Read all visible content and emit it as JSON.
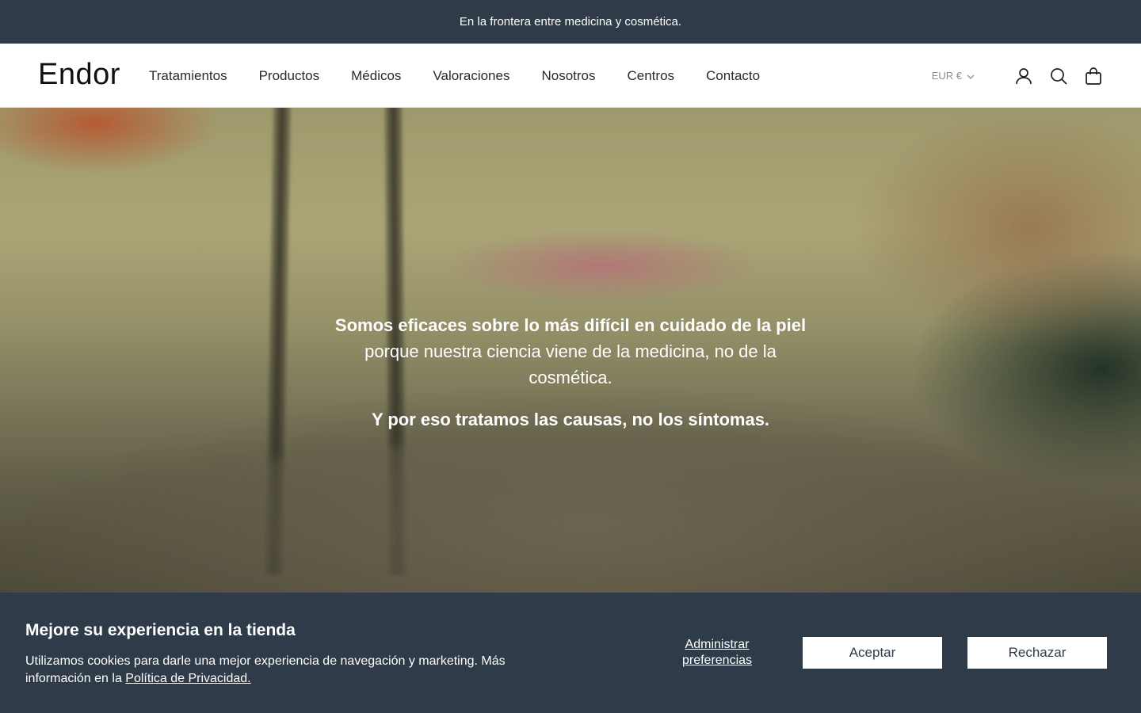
{
  "announcement": {
    "text": "En la frontera entre medicina y cosmética."
  },
  "header": {
    "logo": "Endor",
    "nav": [
      "Tratamientos",
      "Productos",
      "Médicos",
      "Valoraciones",
      "Nosotros",
      "Centros",
      "Contacto"
    ],
    "currency": "EUR €",
    "icons": [
      "account-icon",
      "search-icon",
      "cart-icon"
    ]
  },
  "hero": {
    "lead": "Somos eficaces sobre lo más difícil en cuidado de la piel",
    "body": "porque nuestra ciencia viene de la medicina, no de la cosmética.",
    "emphasis": "Y por eso tratamos las causas, no los síntomas."
  },
  "cookie_banner": {
    "title": "Mejore su experiencia en la tienda",
    "text": "Utilizamos cookies para darle una mejor experiencia de navegación y marketing. Más información en la",
    "policy_link": "Política de Privacidad.",
    "manage_label": "Administrar preferencias",
    "accept_label": "Aceptar",
    "reject_label": "Rechazar"
  },
  "colors": {
    "dark_bar": "#2f3b49",
    "white": "#ffffff"
  }
}
